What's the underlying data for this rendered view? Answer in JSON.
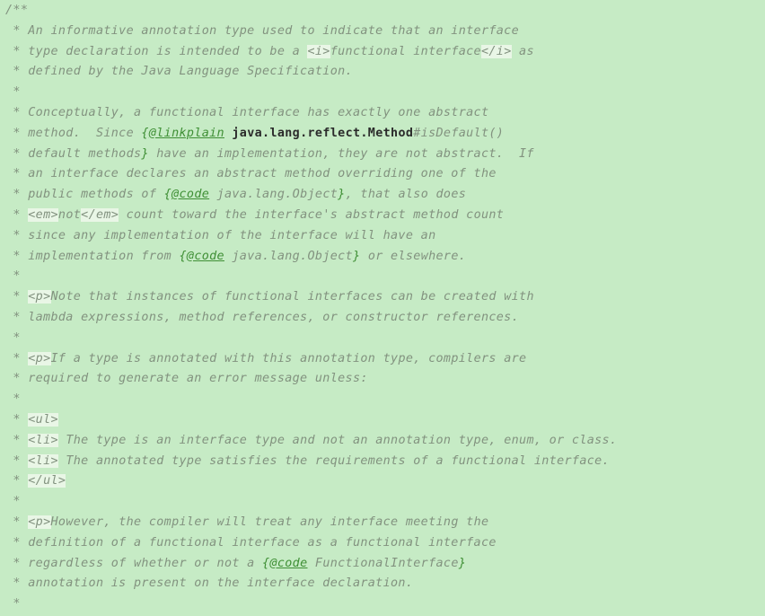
{
  "editor": {
    "language": "java",
    "content_kind": "javadoc-comment",
    "colors": {
      "background": "#c6ebc5",
      "comment_text": "#82927f",
      "javadoc_tag": "#3f8f35",
      "reference_bold": "#2b2b2b",
      "html_tag_highlight": "#e9f6e6"
    },
    "lines": [
      {
        "id": "l1",
        "segments": [
          {
            "t": "/**",
            "k": "comment"
          }
        ]
      },
      {
        "id": "l2",
        "segments": [
          {
            "t": " * An informative annotation type used to indicate that an interface",
            "k": "comment"
          }
        ]
      },
      {
        "id": "l3",
        "segments": [
          {
            "t": " * type declaration is intended to be a ",
            "k": "comment"
          },
          {
            "t": "<i>",
            "k": "htmltag"
          },
          {
            "t": "functional interface",
            "k": "comment"
          },
          {
            "t": "</i>",
            "k": "htmltag"
          },
          {
            "t": " as",
            "k": "comment"
          }
        ]
      },
      {
        "id": "l4",
        "segments": [
          {
            "t": " * defined by the Java Language Specification.",
            "k": "comment"
          }
        ]
      },
      {
        "id": "l5",
        "segments": [
          {
            "t": " *",
            "k": "comment"
          }
        ]
      },
      {
        "id": "l6",
        "segments": [
          {
            "t": " * Conceptually, a functional interface has exactly one abstract",
            "k": "comment"
          }
        ]
      },
      {
        "id": "l7",
        "segments": [
          {
            "t": " * method.  Since ",
            "k": "comment"
          },
          {
            "t": "{",
            "k": "jdtag"
          },
          {
            "t": "@linkplain",
            "k": "jdtag-name"
          },
          {
            "t": " ",
            "k": "comment"
          },
          {
            "t": "java.lang.reflect.Method",
            "k": "ref"
          },
          {
            "t": "#isDefault()",
            "k": "comment"
          }
        ]
      },
      {
        "id": "l8",
        "segments": [
          {
            "t": " * default methods",
            "k": "comment"
          },
          {
            "t": "}",
            "k": "jdtag"
          },
          {
            "t": " have an implementation, they are not abstract.  If",
            "k": "comment"
          }
        ]
      },
      {
        "id": "l9",
        "segments": [
          {
            "t": " * an interface declares an abstract method overriding one of the",
            "k": "comment"
          }
        ]
      },
      {
        "id": "l10",
        "segments": [
          {
            "t": " * public methods of ",
            "k": "comment"
          },
          {
            "t": "{",
            "k": "jdtag"
          },
          {
            "t": "@code",
            "k": "jdtag-name"
          },
          {
            "t": " java.lang.Object",
            "k": "comment"
          },
          {
            "t": "}",
            "k": "jdtag"
          },
          {
            "t": ", that also does",
            "k": "comment"
          }
        ]
      },
      {
        "id": "l11",
        "segments": [
          {
            "t": " * ",
            "k": "comment"
          },
          {
            "t": "<em>",
            "k": "htmltag"
          },
          {
            "t": "not",
            "k": "comment"
          },
          {
            "t": "</em>",
            "k": "htmltag"
          },
          {
            "t": " count toward the interface's abstract method count",
            "k": "comment"
          }
        ]
      },
      {
        "id": "l12",
        "segments": [
          {
            "t": " * since any implementation of the interface will have an",
            "k": "comment"
          }
        ]
      },
      {
        "id": "l13",
        "segments": [
          {
            "t": " * implementation from ",
            "k": "comment"
          },
          {
            "t": "{",
            "k": "jdtag"
          },
          {
            "t": "@code",
            "k": "jdtag-name"
          },
          {
            "t": " java.lang.Object",
            "k": "comment"
          },
          {
            "t": "}",
            "k": "jdtag"
          },
          {
            "t": " or elsewhere.",
            "k": "comment"
          }
        ]
      },
      {
        "id": "l14",
        "segments": [
          {
            "t": " *",
            "k": "comment"
          }
        ]
      },
      {
        "id": "l15",
        "segments": [
          {
            "t": " * ",
            "k": "comment"
          },
          {
            "t": "<p>",
            "k": "htmltag"
          },
          {
            "t": "Note that instances of functional interfaces can be created with",
            "k": "comment"
          }
        ]
      },
      {
        "id": "l16",
        "segments": [
          {
            "t": " * lambda expressions, method references, or constructor references.",
            "k": "comment"
          }
        ]
      },
      {
        "id": "l17",
        "segments": [
          {
            "t": " *",
            "k": "comment"
          }
        ]
      },
      {
        "id": "l18",
        "segments": [
          {
            "t": " * ",
            "k": "comment"
          },
          {
            "t": "<p>",
            "k": "htmltag"
          },
          {
            "t": "If a type is annotated with this annotation type, compilers are",
            "k": "comment"
          }
        ]
      },
      {
        "id": "l19",
        "segments": [
          {
            "t": " * required to generate an error message unless:",
            "k": "comment"
          }
        ]
      },
      {
        "id": "l20",
        "segments": [
          {
            "t": " *",
            "k": "comment"
          }
        ]
      },
      {
        "id": "l21",
        "segments": [
          {
            "t": " * ",
            "k": "comment"
          },
          {
            "t": "<ul>",
            "k": "htmltag"
          }
        ]
      },
      {
        "id": "l22",
        "segments": [
          {
            "t": " * ",
            "k": "comment"
          },
          {
            "t": "<li>",
            "k": "htmltag"
          },
          {
            "t": " The type is an interface type and not an annotation type, enum, or class.",
            "k": "comment"
          }
        ]
      },
      {
        "id": "l23",
        "segments": [
          {
            "t": " * ",
            "k": "comment"
          },
          {
            "t": "<li>",
            "k": "htmltag"
          },
          {
            "t": " The annotated type satisfies the requirements of a functional interface.",
            "k": "comment"
          }
        ]
      },
      {
        "id": "l24",
        "segments": [
          {
            "t": " * ",
            "k": "comment"
          },
          {
            "t": "</ul>",
            "k": "htmltag"
          }
        ]
      },
      {
        "id": "l25",
        "segments": [
          {
            "t": " *",
            "k": "comment"
          }
        ]
      },
      {
        "id": "l26",
        "segments": [
          {
            "t": " * ",
            "k": "comment"
          },
          {
            "t": "<p>",
            "k": "htmltag"
          },
          {
            "t": "However, the compiler will treat any interface meeting the",
            "k": "comment"
          }
        ]
      },
      {
        "id": "l27",
        "segments": [
          {
            "t": " * definition of a functional interface as a functional interface",
            "k": "comment"
          }
        ]
      },
      {
        "id": "l28",
        "segments": [
          {
            "t": " * regardless of whether or not a ",
            "k": "comment"
          },
          {
            "t": "{",
            "k": "jdtag"
          },
          {
            "t": "@code",
            "k": "jdtag-name"
          },
          {
            "t": " FunctionalInterface",
            "k": "comment"
          },
          {
            "t": "}",
            "k": "jdtag"
          }
        ]
      },
      {
        "id": "l29",
        "segments": [
          {
            "t": " * annotation is present on the interface declaration.",
            "k": "comment"
          }
        ]
      },
      {
        "id": "l30",
        "segments": [
          {
            "t": " *",
            "k": "comment"
          }
        ]
      }
    ]
  }
}
